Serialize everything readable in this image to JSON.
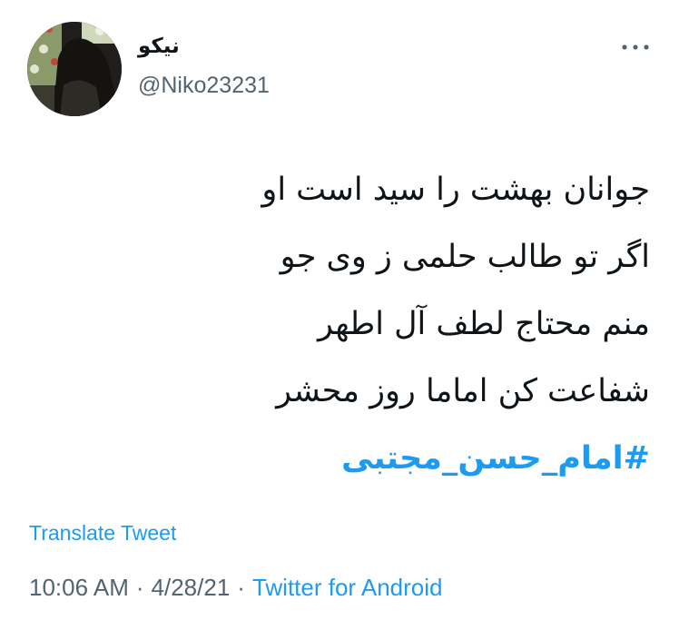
{
  "author": {
    "display_name": "نیکو",
    "username": "@Niko23231"
  },
  "tweet": {
    "lines": [
      "جوانان بهشت را سید است او",
      "اگر تو طالب حلمی ز وی جو",
      "منم محتاج لطف آل اطهر",
      "شفاعت کن اماما روز محشر"
    ],
    "hashtag": "#امام_حسن_مجتبی"
  },
  "actions": {
    "translate_label": "Translate Tweet",
    "more_icon": "more-horizontal-icon"
  },
  "meta": {
    "time": "10:06 AM",
    "date": "4/28/21",
    "separator": "·",
    "source": "Twitter for Android"
  },
  "colors": {
    "link": "#1d9bf0",
    "secondary": "#536471",
    "text": "#0f1419"
  }
}
